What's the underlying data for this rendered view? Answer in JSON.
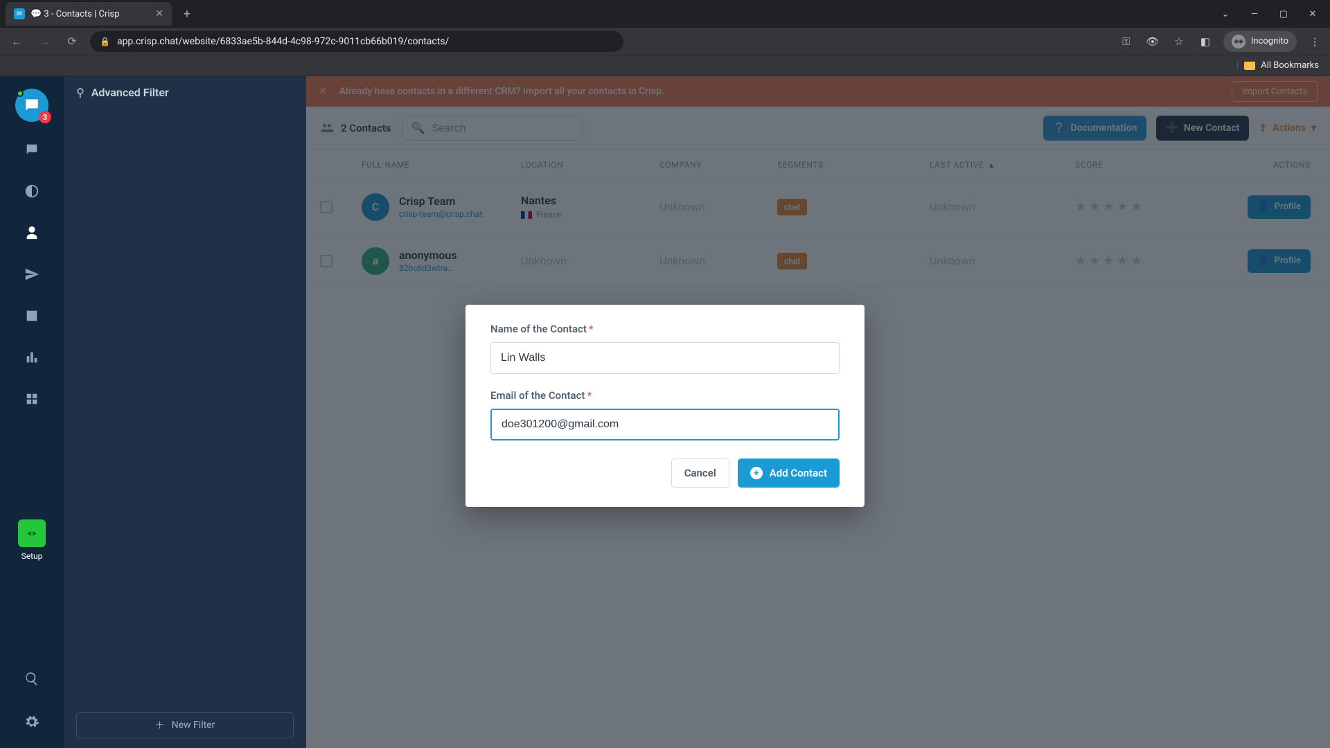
{
  "browser": {
    "tab_title": "💬 3 - Contacts | Crisp",
    "url": "app.crisp.chat/website/6833ae5b-844d-4c98-972c-9011cb66b019/contacts/",
    "incognito_label": "Incognito",
    "all_bookmarks": "All Bookmarks"
  },
  "rail": {
    "badge": "3",
    "setup_label": "Setup"
  },
  "sidebar": {
    "advanced_filter": "Advanced Filter",
    "new_filter": "New Filter"
  },
  "banner": {
    "text": "Already have contacts in a different CRM? Import all your contacts in Crisp.",
    "import": "Import Contacts"
  },
  "toolbar": {
    "count_text": "2 Contacts",
    "search_placeholder": "Search",
    "documentation": "Documentation",
    "new_contact": "New Contact",
    "actions": "Actions"
  },
  "columns": {
    "full_name": "FULL NAME",
    "location": "LOCATION",
    "company": "COMPANY",
    "segments": "SEGMENTS",
    "last_active": "LAST ACTIVE",
    "score": "SCORE",
    "actions": "ACTIONS"
  },
  "rows": [
    {
      "name": "Crisp Team",
      "email": "crisp-team@crisp.chat",
      "city": "Nantes",
      "country": "France",
      "company": "Unknown",
      "segment": "chat",
      "last_active": "Unknown",
      "profile": "Profile",
      "avatar_bg": "#1b9ad6"
    },
    {
      "name": "anonymous",
      "email": "82bc6d3wtra…",
      "city": "Unknown",
      "country": "",
      "company": "Unknown",
      "segment": "chat",
      "last_active": "Unknown",
      "profile": "Profile",
      "avatar_bg": "#36b37e"
    }
  ],
  "modal": {
    "name_label": "Name of the Contact",
    "name_value": "Lin Walls",
    "email_label": "Email of the Contact",
    "email_value": "doe301200@gmail.com",
    "cancel": "Cancel",
    "add": "Add Contact"
  }
}
